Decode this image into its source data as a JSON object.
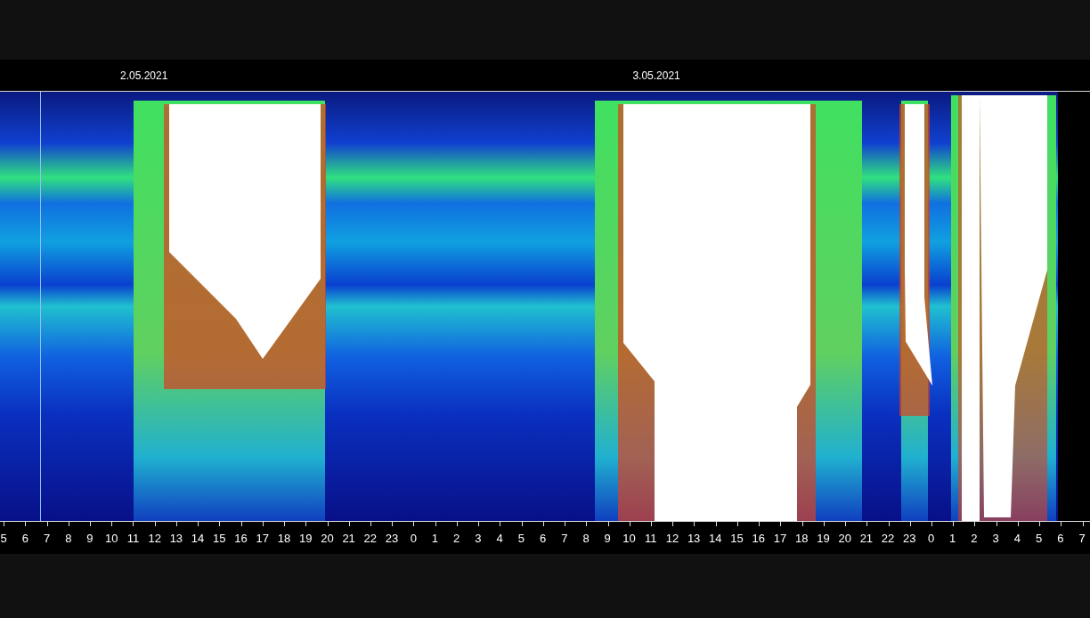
{
  "date_labels": [
    "2.05.2021",
    "3.05.2021"
  ],
  "hour_labels": [
    "5",
    "6",
    "7",
    "8",
    "9",
    "10",
    "11",
    "12",
    "13",
    "14",
    "15",
    "16",
    "17",
    "18",
    "19",
    "20",
    "21",
    "22",
    "23",
    "0",
    "1",
    "2",
    "3",
    "4",
    "5",
    "6",
    "7",
    "8",
    "9",
    "10",
    "11",
    "12",
    "13",
    "14",
    "15",
    "16",
    "17",
    "18",
    "19",
    "20",
    "21",
    "22",
    "23",
    "0",
    "1",
    "2",
    "3",
    "4",
    "5",
    "6",
    "7"
  ]
}
